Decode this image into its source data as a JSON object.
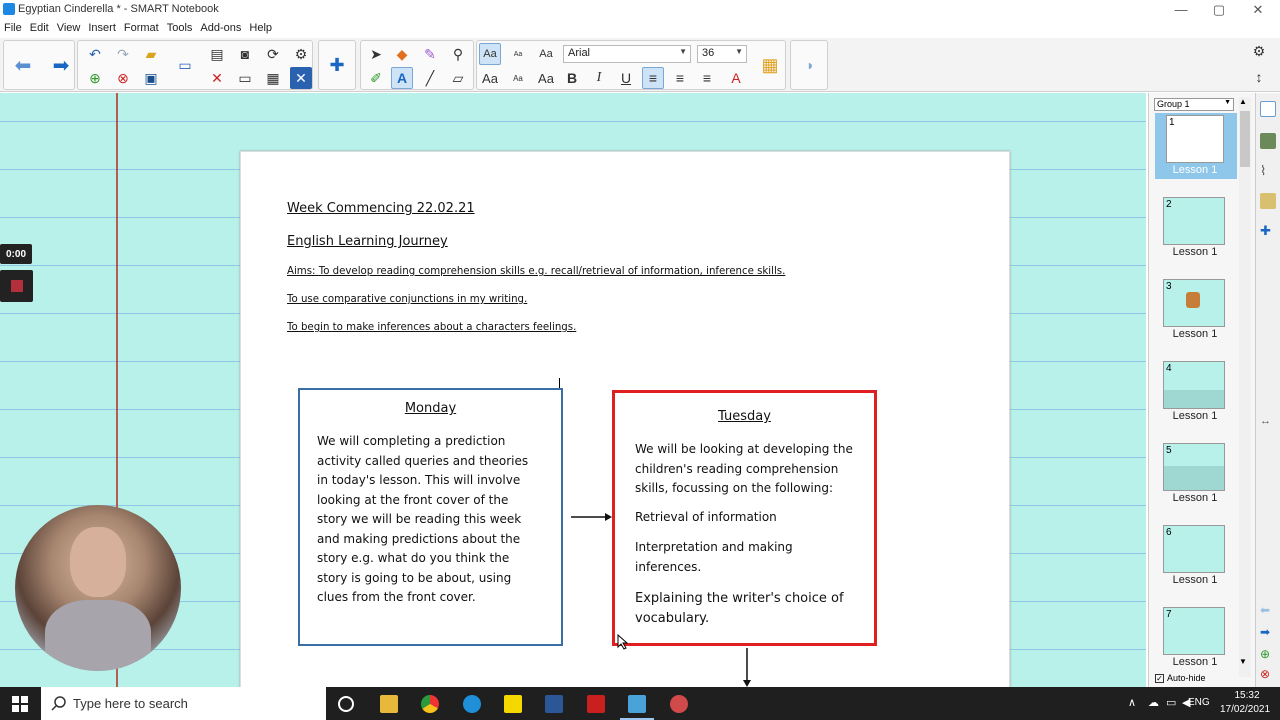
{
  "window": {
    "title": "Egyptian Cinderella * - SMART Notebook",
    "minimize": "—",
    "maximize": "▢",
    "close": "✕"
  },
  "menu": [
    "File",
    "Edit",
    "View",
    "Insert",
    "Format",
    "Tools",
    "Add-ons",
    "Help"
  ],
  "toolbar": {
    "font_name": "Arial",
    "font_size": "36",
    "text_aa_large": "Aa",
    "text_aa_small": "Aa",
    "bold": "B",
    "italic": "I",
    "underline": "U"
  },
  "recorder": {
    "time": "0:00"
  },
  "page": {
    "lines": [
      "Week Commencing 22.02.21",
      "English Learning Journey",
      "Aims: To develop reading comprehension skills e.g. recall/retrieval of information, inference skills.",
      "To use comparative conjunctions in my writing.",
      "To begin to make inferences about a characters feelings."
    ],
    "monday": {
      "title": "Monday",
      "body": "We will completing a prediction activity called queries and theories in today's lesson. This will involve looking at the front cover of the story we will be reading this week and making predictions about the story e.g. what do you think the story is going to be about, using clues from the front cover.",
      "border_color": "#3b6ea5"
    },
    "tuesday": {
      "title": "Tuesday",
      "intro": "We will be looking at developing the children's reading comprehension skills, focussing on the following:",
      "item1": "Retrieval of information",
      "item2": "Interpretation and making inferences.",
      "item3": "Explaining the writer's choice of vocabulary.",
      "border_color": "#e02020"
    }
  },
  "sidebar": {
    "group": "Group 1",
    "pages": [
      {
        "num": "1",
        "label": "Lesson 1"
      },
      {
        "num": "2",
        "label": "Lesson 1"
      },
      {
        "num": "3",
        "label": "Lesson 1"
      },
      {
        "num": "4",
        "label": "Lesson 1"
      },
      {
        "num": "5",
        "label": "Lesson 1"
      },
      {
        "num": "6",
        "label": "Lesson 1"
      },
      {
        "num": "7",
        "label": "Lesson 1"
      }
    ],
    "autohide": "Auto-hide"
  },
  "taskbar": {
    "search_placeholder": "Type here to search",
    "language": "ENG",
    "time": "15:32",
    "date": "17/02/2021"
  },
  "colors": {
    "canvas_bg": "#b7f1ea",
    "margin_line": "#b3443a",
    "ruled_line": "#8fc7e6",
    "accent": "#1e88e5"
  }
}
